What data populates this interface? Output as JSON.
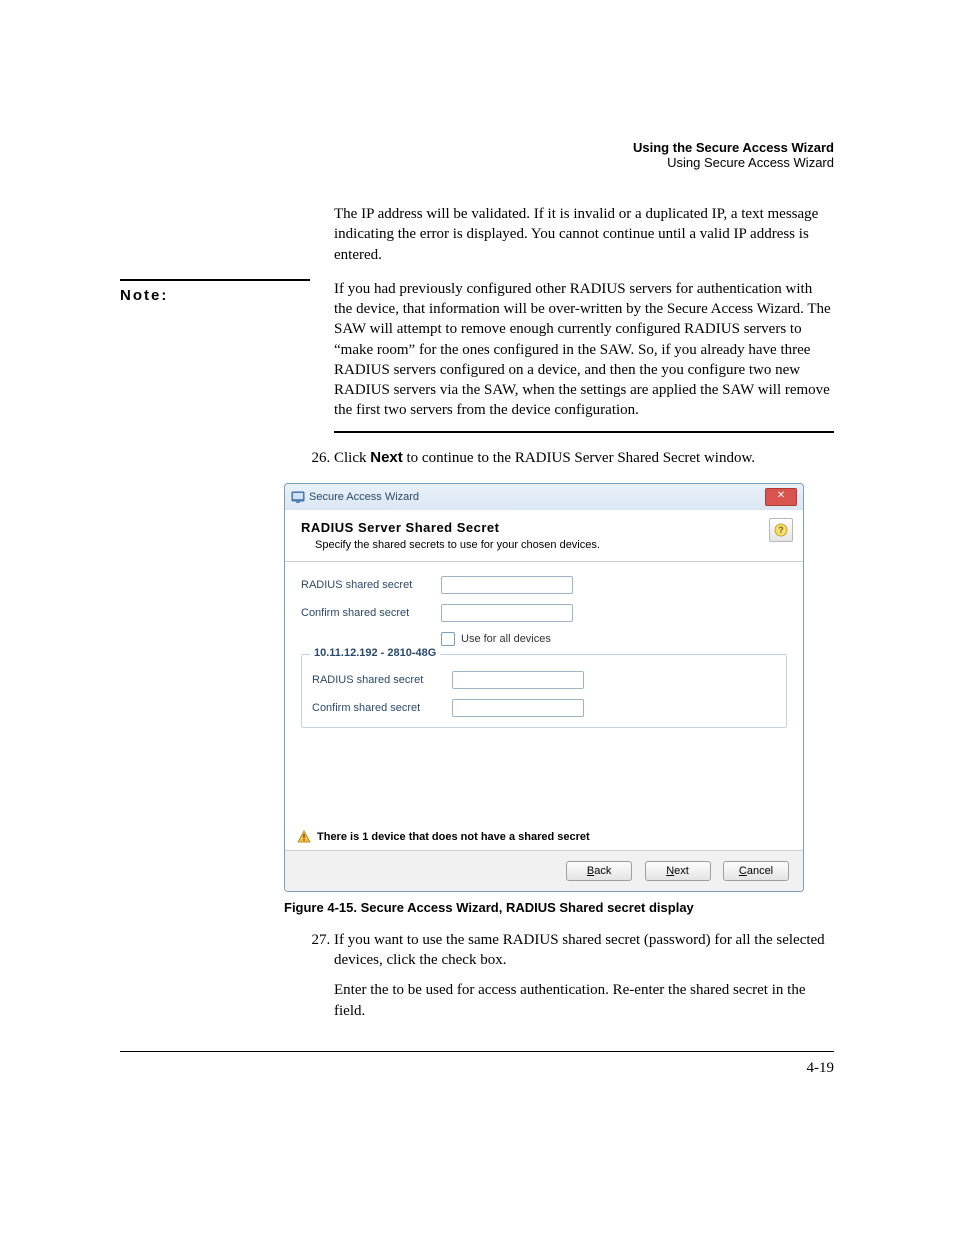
{
  "header": {
    "chapter_title": "Using the Secure Access Wizard",
    "section_title": "Using Secure Access Wizard"
  },
  "intro_para": "The IP address will be validated. If it is invalid or a duplicated IP, a text message indicating the error is displayed. You cannot continue until a valid IP address is entered.",
  "note": {
    "label": "Note:",
    "text": "If you had previously configured other RADIUS servers for authentication with the device, that information will be over-written by the Secure Access Wizard. The SAW will attempt to remove enough currently configured RADIUS servers to “make room” for the ones configured in the SAW. So, if you already have three RADIUS servers configured on a device, and then the you configure two new RADIUS servers via the SAW, when the settings are applied the SAW will remove the first two servers from the device configuration."
  },
  "step26": {
    "num": 26,
    "lead": "Click ",
    "next_label": "Next",
    "tail": " to continue to the RADIUS Server Shared Secret window."
  },
  "wizard": {
    "window_title": "Secure Access Wizard",
    "header_title": "RADIUS Server Shared Secret",
    "header_sub": "Specify the shared secrets to use for your chosen devices.",
    "labels": {
      "radius_shared_secret": "RADIUS shared secret",
      "confirm_shared_secret": "Confirm shared secret",
      "use_for_all": "Use for all devices"
    },
    "device_legend": "10.11.12.192  - 2810-48G",
    "warning": "There is 1 device that does not have a shared secret",
    "buttons": {
      "back": "Back",
      "next": "Next",
      "cancel": "Cancel"
    }
  },
  "figure_caption": "Figure 4-15. Secure Access Wizard, RADIUS Shared secret display",
  "step27": {
    "num": 27,
    "line1a": "If you want to use the same RADIUS shared secret (password) for all the selected devices, click the ",
    "line1b": " check box.",
    "line2a": "Enter the ",
    "line2b": " to be used for access authentication. Re-enter the shared secret in the ",
    "line2c": " field."
  },
  "page_number": "4-19"
}
